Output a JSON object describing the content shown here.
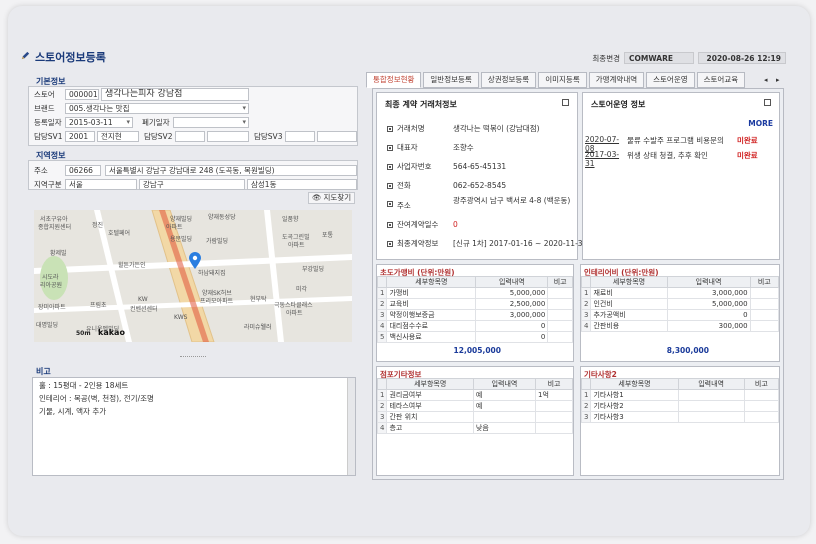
{
  "page_title": "스토어정보등록",
  "top": {
    "change_label": "최종변경",
    "user": "COMWARE",
    "datetime": "2020-08-26 12:19"
  },
  "basic": {
    "section": "기본정보",
    "store_label": "스토어",
    "store_code": "000001",
    "store_name": "생각나는피자 강남점",
    "brand_label": "브랜드",
    "brand_value": "005.생각나는 맛집",
    "reg_date_label": "등록일자",
    "reg_date": "2015-03-11",
    "close_date_label": "폐기일자",
    "sv1_label": "담당SV1",
    "sv1_code": "2001",
    "sv1_name": "전지현",
    "sv2_label": "담당SV2",
    "sv3_label": "담당SV3"
  },
  "region": {
    "section": "지역정보",
    "addr_label": "주소",
    "zip": "06266",
    "address": "서울특별시 강남구 강남대로 248 (도곡동, 목원빌딩)",
    "zone_label": "지역구분",
    "zone1": "서울",
    "zone2": "강남구",
    "zone3": "삼성1동",
    "map_button": "지도찾기"
  },
  "map": {
    "labels": [
      "서초구유아",
      "종합지원센터",
      "정진",
      "호텔페어",
      "양재동성당",
      "일품향",
      "양재빌딩",
      "아파트",
      "용문빌딩",
      "가람빌딩",
      "도곡그린빌",
      "아파트",
      "포통",
      "황제빌",
      "힐튼가든인",
      "하남돼지집",
      "부강빌딩",
      "미각",
      "시도라",
      "리아공원",
      "장미아파트",
      "프림초",
      "KW",
      "컨벤션센터",
      "양재SK허브",
      "프리모아파트",
      "현부탁",
      "극동스타클래스",
      "아파트",
      "라미슈웰러",
      "KWS",
      "대명빌딩",
      "유니온벨빌딩"
    ],
    "scale": "50m",
    "brand": "kakao"
  },
  "note": {
    "section": "비고",
    "lines": [
      "홀 : 15평대 - 2인용 18세트",
      "인테리어 : 목공(벽, 천정), 전기/조명",
      "기물, 시계, 액자 추가"
    ]
  },
  "tabs": [
    {
      "label": "통합정보현황",
      "active": true
    },
    {
      "label": "일반정보등록",
      "active": false
    },
    {
      "label": "상권정보등록",
      "active": false
    },
    {
      "label": "이미지등록",
      "active": false
    },
    {
      "label": "가맹계약내역",
      "active": false
    },
    {
      "label": "스토어운영",
      "active": false
    },
    {
      "label": "스토어교육",
      "active": false
    }
  ],
  "contract": {
    "title": "최종 계약 거래처정보",
    "rows": [
      {
        "label": "거래처명",
        "value": "생각나는 떡볶이 (강남대점)"
      },
      {
        "label": "대표자",
        "value": "조향수"
      },
      {
        "label": "사업자번호",
        "value": "564-65-45131"
      },
      {
        "label": "전화",
        "value": "062-652-8545"
      },
      {
        "label": "주소",
        "value": "광주광역시 남구 백서로 4-8 (백운동)"
      },
      {
        "label": "잔여계약일수",
        "value": "0"
      },
      {
        "label": "최종계약정보",
        "value": "[신규 1차] 2017-01-16 ~ 2020-11-30"
      }
    ]
  },
  "ops": {
    "title": "스토어운영 정보",
    "more": "MORE",
    "rows": [
      {
        "date": "2020-07-08",
        "text": "물류 수발주 프로그램 비용문의",
        "status": "미완료"
      },
      {
        "date": "2017-03-31",
        "text": "위생 상태 청결, 추후 확인",
        "status": "미완료"
      }
    ]
  },
  "initial_cost": {
    "title": "초도가맹비 (단위:만원)",
    "headers": [
      "세부항목명",
      "입력내역",
      "비고"
    ],
    "rows": [
      [
        "1",
        "가맹비",
        "5,000,000",
        ""
      ],
      [
        "2",
        "교육비",
        "2,500,000",
        ""
      ],
      [
        "3",
        "약정이행보증금",
        "3,000,000",
        ""
      ],
      [
        "4",
        "대리점수수료",
        "0",
        ""
      ],
      [
        "5",
        "백신사용료",
        "0",
        ""
      ]
    ],
    "total": "12,005,000"
  },
  "interior_cost": {
    "title": "인테리어비 (단위:만원)",
    "headers": [
      "세부항목명",
      "입력내역",
      "비고"
    ],
    "rows": [
      [
        "1",
        "재료비",
        "3,000,000",
        ""
      ],
      [
        "2",
        "인건비",
        "5,000,000",
        ""
      ],
      [
        "3",
        "추가공액비",
        "0",
        ""
      ],
      [
        "4",
        "간판비용",
        "300,000",
        ""
      ]
    ],
    "total": "8,300,000"
  },
  "store_extra": {
    "title": "점포기타정보",
    "headers": [
      "세부항목명",
      "입력내역",
      "비고"
    ],
    "rows": [
      [
        "1",
        "권리금여부",
        "예",
        "1억"
      ],
      [
        "2",
        "테라스여부",
        "예",
        ""
      ],
      [
        "3",
        "간판 위치",
        "",
        ""
      ],
      [
        "4",
        "층고",
        "낮음",
        ""
      ]
    ]
  },
  "other": {
    "title": "기타사항2",
    "headers": [
      "세부항목명",
      "입력내역",
      "비고"
    ],
    "rows": [
      [
        "1",
        "기타사항1",
        "",
        ""
      ],
      [
        "2",
        "기타사항2",
        "",
        ""
      ],
      [
        "3",
        "기타사항3",
        "",
        ""
      ]
    ]
  },
  "colors": {
    "title": "#1a3a7a",
    "status": "#d02020",
    "total": "#1a3a9a"
  }
}
